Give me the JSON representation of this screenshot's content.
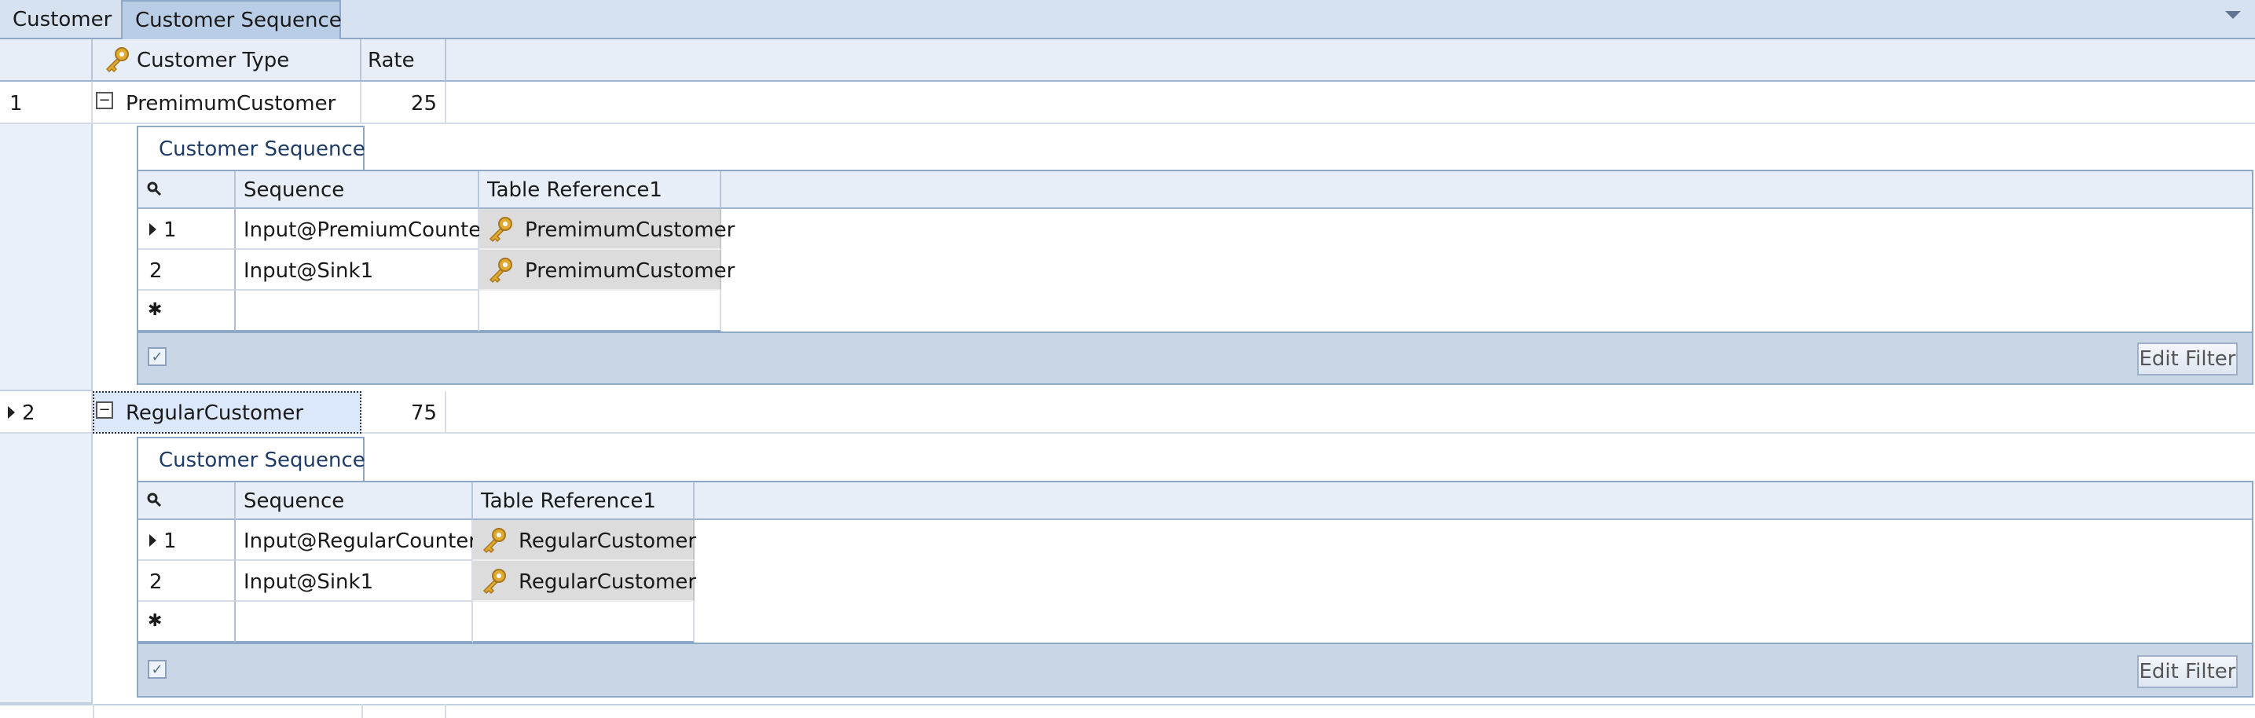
{
  "tabs": [
    "Customer",
    "Customer Sequence"
  ],
  "grid": {
    "columns": {
      "type": "Customer Type",
      "rate": "Rate"
    },
    "rows": [
      {
        "num": "1",
        "type": "PremimumCustomer",
        "rate": "25",
        "detail": {
          "tab": "Customer Sequence",
          "columns": {
            "seq": "Sequence",
            "ref": "Table Reference1"
          },
          "rows": [
            {
              "num": "1",
              "seq": "Input@PremiumCounter",
              "ref": "PremimumCustomer"
            },
            {
              "num": "2",
              "seq": "Input@Sink1",
              "ref": "PremimumCustomer"
            }
          ],
          "new_row_symbol": "✱",
          "filter_button": "Edit Filter"
        }
      },
      {
        "num": "2",
        "type": "RegularCustomer",
        "rate": "75",
        "detail": {
          "tab": "Customer Sequence",
          "columns": {
            "seq": "Sequence",
            "ref": "Table Reference1"
          },
          "rows": [
            {
              "num": "1",
              "seq": "Input@RegularCounter",
              "ref": "RegularCustomer"
            },
            {
              "num": "2",
              "seq": "Input@Sink1",
              "ref": "RegularCustomer"
            }
          ],
          "new_row_symbol": "✱",
          "filter_button": "Edit Filter"
        }
      }
    ]
  },
  "icons": {
    "key_icon": "key-icon",
    "search_icon": "search-icon",
    "collapse_icon": "collapse-icon",
    "row_indicator": "row-indicator-arrow",
    "dropdown": "dropdown-arrow-icon",
    "checkbox": "filter-checkbox"
  },
  "colors": {
    "tabstrip": "#d6e2f0",
    "selected_tab": "#b9cde6",
    "header": "#e7eef7",
    "border": "#8da7c6",
    "footer": "#c9d6e6",
    "reference_cell": "#dcdcdc",
    "focused_cell": "#dbe8fb",
    "key_gold": "#e0a92f"
  }
}
